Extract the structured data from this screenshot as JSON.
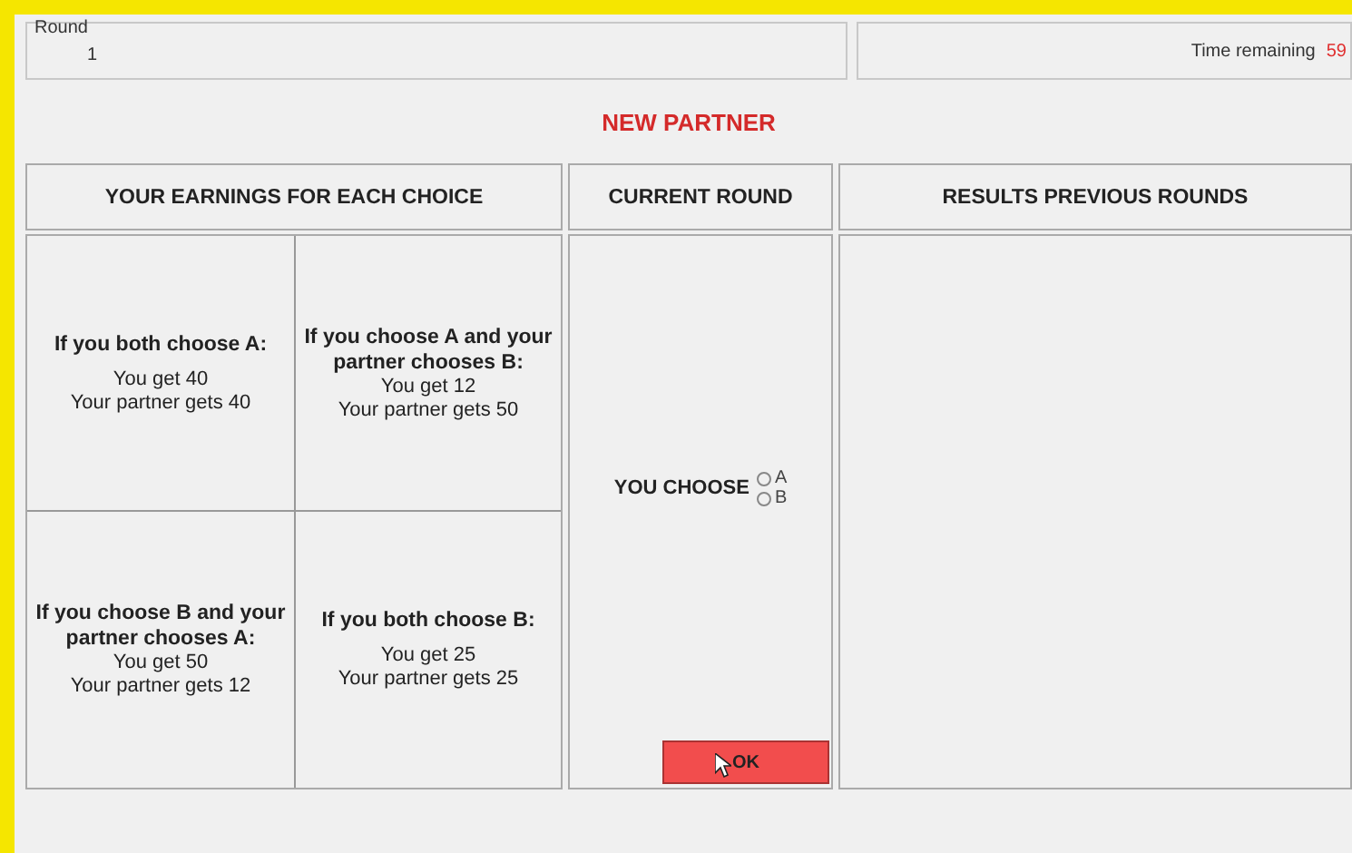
{
  "round": {
    "label": "Round",
    "value": "1"
  },
  "timer": {
    "label": "Time remaining",
    "value": "59"
  },
  "notice": "NEW PARTNER",
  "columns": [
    "YOUR EARNINGS FOR EACH CHOICE",
    "CURRENT ROUND",
    "RESULTS PREVIOUS ROUNDS"
  ],
  "payoffs": [
    {
      "condition": "If you both choose A:",
      "you": "You get 40",
      "partner": "Your partner gets 40"
    },
    {
      "condition": "If you choose A and your partner chooses B:",
      "you": "You get 12",
      "partner": "Your partner gets 50"
    },
    {
      "condition": "If you choose B and your partner chooses A:",
      "you": "You get 50",
      "partner": "Your partner gets 12"
    },
    {
      "condition": "If you both choose B:",
      "you": "You get 25",
      "partner": "Your partner gets 25"
    }
  ],
  "choice": {
    "label": "YOU CHOOSE",
    "options": [
      {
        "label": "A",
        "selected": false
      },
      {
        "label": "B",
        "selected": false
      }
    ]
  },
  "ok_button": "OK"
}
